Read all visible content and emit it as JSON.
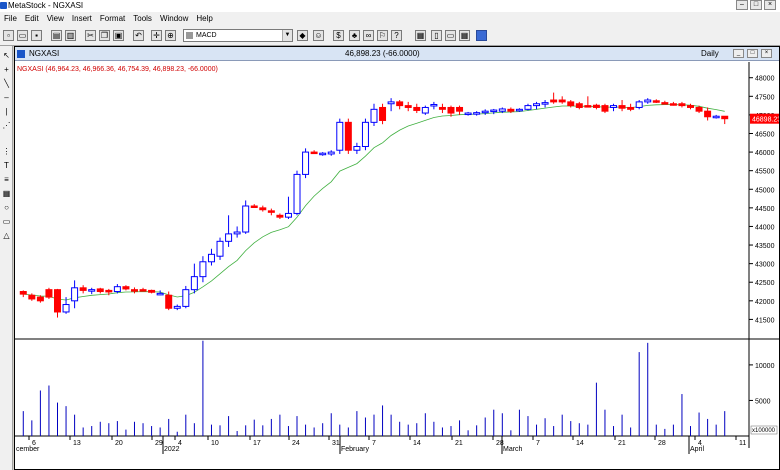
{
  "window": {
    "title": "MetaStock - NGXASI"
  },
  "menu": [
    "File",
    "Edit",
    "View",
    "Insert",
    "Format",
    "Tools",
    "Window",
    "Help"
  ],
  "toolbar": {
    "indicator_combo": "MACD"
  },
  "chart_window": {
    "symbol": "NGXASI",
    "last_price_label": "46,898.23 (-66.0000)",
    "period": "Daily",
    "legend": "NGXASI (46,964.23, 46,966.36, 46,754.39, 46,898.23, -66.0000)",
    "price_tag": "46898.23",
    "volume_scale_label": "x100000"
  },
  "colors": {
    "up": "#0000ff",
    "down": "#ff0000",
    "ma": "#40b040",
    "price_tag_bg": "#ff0000"
  },
  "chart_data": {
    "type": "candlestick",
    "price_axis": {
      "ticks": [
        41500,
        42000,
        42500,
        43000,
        43500,
        44000,
        44500,
        45000,
        45500,
        46000,
        46500,
        47000,
        47500,
        48000
      ],
      "range": [
        41000,
        48100
      ]
    },
    "volume_axis": {
      "ticks": [
        5000,
        10000
      ],
      "range": [
        0,
        13500
      ]
    },
    "x_tick_labels": [
      "6",
      "13",
      "20",
      "29",
      "4",
      "10",
      "17",
      "24",
      "31",
      "7",
      "14",
      "21",
      "28",
      "7",
      "14",
      "21",
      "28",
      "4",
      "11"
    ],
    "month_labels": [
      "cember",
      "2022",
      "February",
      "March",
      "April"
    ],
    "candles": [
      {
        "o": 42250,
        "h": 42280,
        "l": 42100,
        "c": 42180,
        "v": 3500
      },
      {
        "o": 42150,
        "h": 42200,
        "l": 42000,
        "c": 42050,
        "v": 2200
      },
      {
        "o": 42100,
        "h": 42150,
        "l": 41950,
        "c": 42000,
        "v": 6400
      },
      {
        "o": 42300,
        "h": 42350,
        "l": 42050,
        "c": 42100,
        "v": 7100
      },
      {
        "o": 42300,
        "h": 42320,
        "l": 41550,
        "c": 41700,
        "v": 4700
      },
      {
        "o": 41700,
        "h": 42100,
        "l": 41650,
        "c": 41900,
        "v": 4200
      },
      {
        "o": 42000,
        "h": 42550,
        "l": 41800,
        "c": 42350,
        "v": 3000
      },
      {
        "o": 42350,
        "h": 42420,
        "l": 42200,
        "c": 42280,
        "v": 1200
      },
      {
        "o": 42260,
        "h": 42350,
        "l": 42180,
        "c": 42300,
        "v": 1400
      },
      {
        "o": 42320,
        "h": 42350,
        "l": 42200,
        "c": 42250,
        "v": 2000
      },
      {
        "o": 42280,
        "h": 42320,
        "l": 42150,
        "c": 42250,
        "v": 1800
      },
      {
        "o": 42250,
        "h": 42450,
        "l": 42200,
        "c": 42380,
        "v": 2100
      },
      {
        "o": 42380,
        "h": 42420,
        "l": 42280,
        "c": 42320,
        "v": 900
      },
      {
        "o": 42300,
        "h": 42360,
        "l": 42200,
        "c": 42260,
        "v": 2000
      },
      {
        "o": 42300,
        "h": 42350,
        "l": 42250,
        "c": 42280,
        "v": 1800
      },
      {
        "o": 42280,
        "h": 42300,
        "l": 42200,
        "c": 42230,
        "v": 1400
      },
      {
        "o": 42200,
        "h": 42280,
        "l": 42150,
        "c": 42200,
        "v": 1200
      },
      {
        "o": 42150,
        "h": 42250,
        "l": 41750,
        "c": 41800,
        "v": 2400
      },
      {
        "o": 41800,
        "h": 41900,
        "l": 41750,
        "c": 41850,
        "v": 600
      },
      {
        "o": 41850,
        "h": 42400,
        "l": 41800,
        "c": 42300,
        "v": 3000
      },
      {
        "o": 42300,
        "h": 43000,
        "l": 42200,
        "c": 42650,
        "v": 1800
      },
      {
        "o": 42650,
        "h": 43200,
        "l": 42500,
        "c": 43050,
        "v": 13400
      },
      {
        "o": 43050,
        "h": 43400,
        "l": 42950,
        "c": 43250,
        "v": 1600
      },
      {
        "o": 43200,
        "h": 43700,
        "l": 43100,
        "c": 43600,
        "v": 1500
      },
      {
        "o": 43600,
        "h": 44300,
        "l": 43450,
        "c": 43800,
        "v": 2800
      },
      {
        "o": 43800,
        "h": 44000,
        "l": 43700,
        "c": 43850,
        "v": 700
      },
      {
        "o": 43850,
        "h": 44700,
        "l": 43800,
        "c": 44550,
        "v": 1500
      },
      {
        "o": 44550,
        "h": 44600,
        "l": 44500,
        "c": 44520,
        "v": 2300
      },
      {
        "o": 44500,
        "h": 44560,
        "l": 44400,
        "c": 44450,
        "v": 1500
      },
      {
        "o": 44420,
        "h": 44480,
        "l": 44300,
        "c": 44380,
        "v": 2400
      },
      {
        "o": 44300,
        "h": 44350,
        "l": 44200,
        "c": 44250,
        "v": 3000
      },
      {
        "o": 44250,
        "h": 44800,
        "l": 44200,
        "c": 44350,
        "v": 1400
      },
      {
        "o": 44350,
        "h": 45500,
        "l": 44300,
        "c": 45400,
        "v": 2800
      },
      {
        "o": 45400,
        "h": 46100,
        "l": 45300,
        "c": 46000,
        "v": 1600
      },
      {
        "o": 46000,
        "h": 46050,
        "l": 45950,
        "c": 45980,
        "v": 1200
      },
      {
        "o": 45950,
        "h": 46000,
        "l": 45900,
        "c": 45970,
        "v": 1800
      },
      {
        "o": 45950,
        "h": 46050,
        "l": 45900,
        "c": 46000,
        "v": 3200
      },
      {
        "o": 46050,
        "h": 46900,
        "l": 45950,
        "c": 46800,
        "v": 1600
      },
      {
        "o": 46800,
        "h": 46900,
        "l": 45950,
        "c": 46050,
        "v": 1200
      },
      {
        "o": 46050,
        "h": 46250,
        "l": 45950,
        "c": 46150,
        "v": 3500
      },
      {
        "o": 46150,
        "h": 46900,
        "l": 46050,
        "c": 46800,
        "v": 2600
      },
      {
        "o": 46800,
        "h": 47300,
        "l": 46700,
        "c": 47150,
        "v": 3000
      },
      {
        "o": 47200,
        "h": 47300,
        "l": 46750,
        "c": 46850,
        "v": 4300
      },
      {
        "o": 47300,
        "h": 47450,
        "l": 47100,
        "c": 47350,
        "v": 3000
      },
      {
        "o": 47350,
        "h": 47400,
        "l": 47150,
        "c": 47250,
        "v": 2000
      },
      {
        "o": 47250,
        "h": 47350,
        "l": 47100,
        "c": 47200,
        "v": 1600
      },
      {
        "o": 47200,
        "h": 47300,
        "l": 47050,
        "c": 47120,
        "v": 1800
      },
      {
        "o": 47050,
        "h": 47250,
        "l": 47000,
        "c": 47200,
        "v": 3200
      },
      {
        "o": 47250,
        "h": 47350,
        "l": 47150,
        "c": 47280,
        "v": 2000
      },
      {
        "o": 47200,
        "h": 47300,
        "l": 47050,
        "c": 47150,
        "v": 1200
      },
      {
        "o": 47200,
        "h": 47250,
        "l": 46950,
        "c": 47050,
        "v": 1400
      },
      {
        "o": 47200,
        "h": 47250,
        "l": 47000,
        "c": 47100,
        "v": 2200
      },
      {
        "o": 47020,
        "h": 47080,
        "l": 46980,
        "c": 47050,
        "v": 800
      },
      {
        "o": 47030,
        "h": 47100,
        "l": 46980,
        "c": 47060,
        "v": 1500
      },
      {
        "o": 47080,
        "h": 47150,
        "l": 47000,
        "c": 47100,
        "v": 2600
      },
      {
        "o": 47100,
        "h": 47160,
        "l": 47020,
        "c": 47130,
        "v": 3700
      },
      {
        "o": 47100,
        "h": 47200,
        "l": 47050,
        "c": 47160,
        "v": 3200
      },
      {
        "o": 47150,
        "h": 47200,
        "l": 47050,
        "c": 47100,
        "v": 800
      },
      {
        "o": 47120,
        "h": 47180,
        "l": 47080,
        "c": 47150,
        "v": 3700
      },
      {
        "o": 47150,
        "h": 47300,
        "l": 47120,
        "c": 47250,
        "v": 2800
      },
      {
        "o": 47250,
        "h": 47350,
        "l": 47150,
        "c": 47300,
        "v": 1600
      },
      {
        "o": 47300,
        "h": 47400,
        "l": 47200,
        "c": 47330,
        "v": 2500
      },
      {
        "o": 47400,
        "h": 47600,
        "l": 47300,
        "c": 47350,
        "v": 1400
      },
      {
        "o": 47400,
        "h": 47500,
        "l": 47300,
        "c": 47350,
        "v": 3000
      },
      {
        "o": 47350,
        "h": 47400,
        "l": 47200,
        "c": 47250,
        "v": 2100
      },
      {
        "o": 47300,
        "h": 47350,
        "l": 47150,
        "c": 47200,
        "v": 1800
      },
      {
        "o": 47250,
        "h": 47500,
        "l": 47200,
        "c": 47230,
        "v": 1600
      },
      {
        "o": 47260,
        "h": 47300,
        "l": 47150,
        "c": 47200,
        "v": 7500
      },
      {
        "o": 47250,
        "h": 47300,
        "l": 47050,
        "c": 47100,
        "v": 3700
      },
      {
        "o": 47200,
        "h": 47300,
        "l": 47100,
        "c": 47250,
        "v": 1400
      },
      {
        "o": 47250,
        "h": 47400,
        "l": 47100,
        "c": 47180,
        "v": 3000
      },
      {
        "o": 47200,
        "h": 47300,
        "l": 47100,
        "c": 47150,
        "v": 1200
      },
      {
        "o": 47200,
        "h": 47400,
        "l": 47150,
        "c": 47350,
        "v": 11800
      },
      {
        "o": 47350,
        "h": 47450,
        "l": 47300,
        "c": 47400,
        "v": 13100
      },
      {
        "o": 47380,
        "h": 47420,
        "l": 47320,
        "c": 47350,
        "v": 1600
      },
      {
        "o": 47330,
        "h": 47380,
        "l": 47280,
        "c": 47300,
        "v": 1000
      },
      {
        "o": 47300,
        "h": 47350,
        "l": 47250,
        "c": 47280,
        "v": 1600
      },
      {
        "o": 47300,
        "h": 47350,
        "l": 47200,
        "c": 47250,
        "v": 5900
      },
      {
        "o": 47250,
        "h": 47300,
        "l": 47150,
        "c": 47200,
        "v": 1400
      },
      {
        "o": 47200,
        "h": 47250,
        "l": 47050,
        "c": 47100,
        "v": 3300
      },
      {
        "o": 47100,
        "h": 47200,
        "l": 46850,
        "c": 46950,
        "v": 2400
      },
      {
        "o": 46950,
        "h": 47000,
        "l": 46900,
        "c": 46964,
        "v": 1600
      },
      {
        "o": 46964,
        "h": 46966,
        "l": 46754,
        "c": 46898,
        "v": 3500
      }
    ]
  }
}
